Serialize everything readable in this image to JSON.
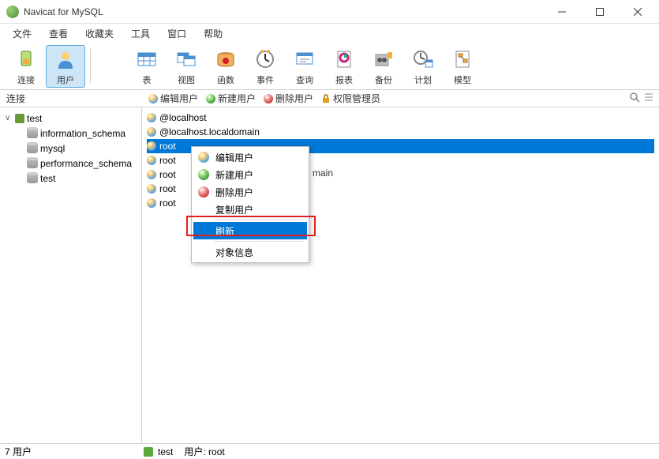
{
  "window": {
    "title": "Navicat for MySQL"
  },
  "menubar": {
    "items": [
      {
        "label": "文件"
      },
      {
        "label": "查看"
      },
      {
        "label": "收藏夹"
      },
      {
        "label": "工具"
      },
      {
        "label": "窗口"
      },
      {
        "label": "帮助"
      }
    ]
  },
  "toolbar": {
    "connect": "连接",
    "user": "用户",
    "table": "表",
    "view": "视图",
    "function": "函数",
    "event": "事件",
    "query": "查询",
    "report": "报表",
    "backup": "备份",
    "plan": "计划",
    "model": "模型"
  },
  "subbar": {
    "left_label": "连接",
    "edit_user": "编辑用户",
    "new_user": "新建用户",
    "delete_user": "删除用户",
    "privilege_mgr": "权限管理员"
  },
  "sidebar": {
    "connection": "test",
    "databases": [
      {
        "name": "information_schema"
      },
      {
        "name": "mysql"
      },
      {
        "name": "performance_schema"
      },
      {
        "name": "test"
      }
    ]
  },
  "users": [
    {
      "name": "@localhost",
      "selected": false
    },
    {
      "name": "@localhost.localdomain",
      "selected": false
    },
    {
      "name": "root",
      "selected": true,
      "truncated": true
    },
    {
      "name": "root",
      "truncated": true
    },
    {
      "name": "root",
      "truncated": true
    },
    {
      "name": "root",
      "truncated": true
    },
    {
      "name": "root",
      "truncated": true
    }
  ],
  "context_menu": {
    "edit_user": "编辑用户",
    "new_user": "新建用户",
    "delete_user": "删除用户",
    "copy_user": "复制用户",
    "refresh": "刷新",
    "object_info": "对象信息",
    "trailing_text": "main"
  },
  "statusbar": {
    "left": "7 用户",
    "conn": "test",
    "user_label": "用户: root"
  }
}
